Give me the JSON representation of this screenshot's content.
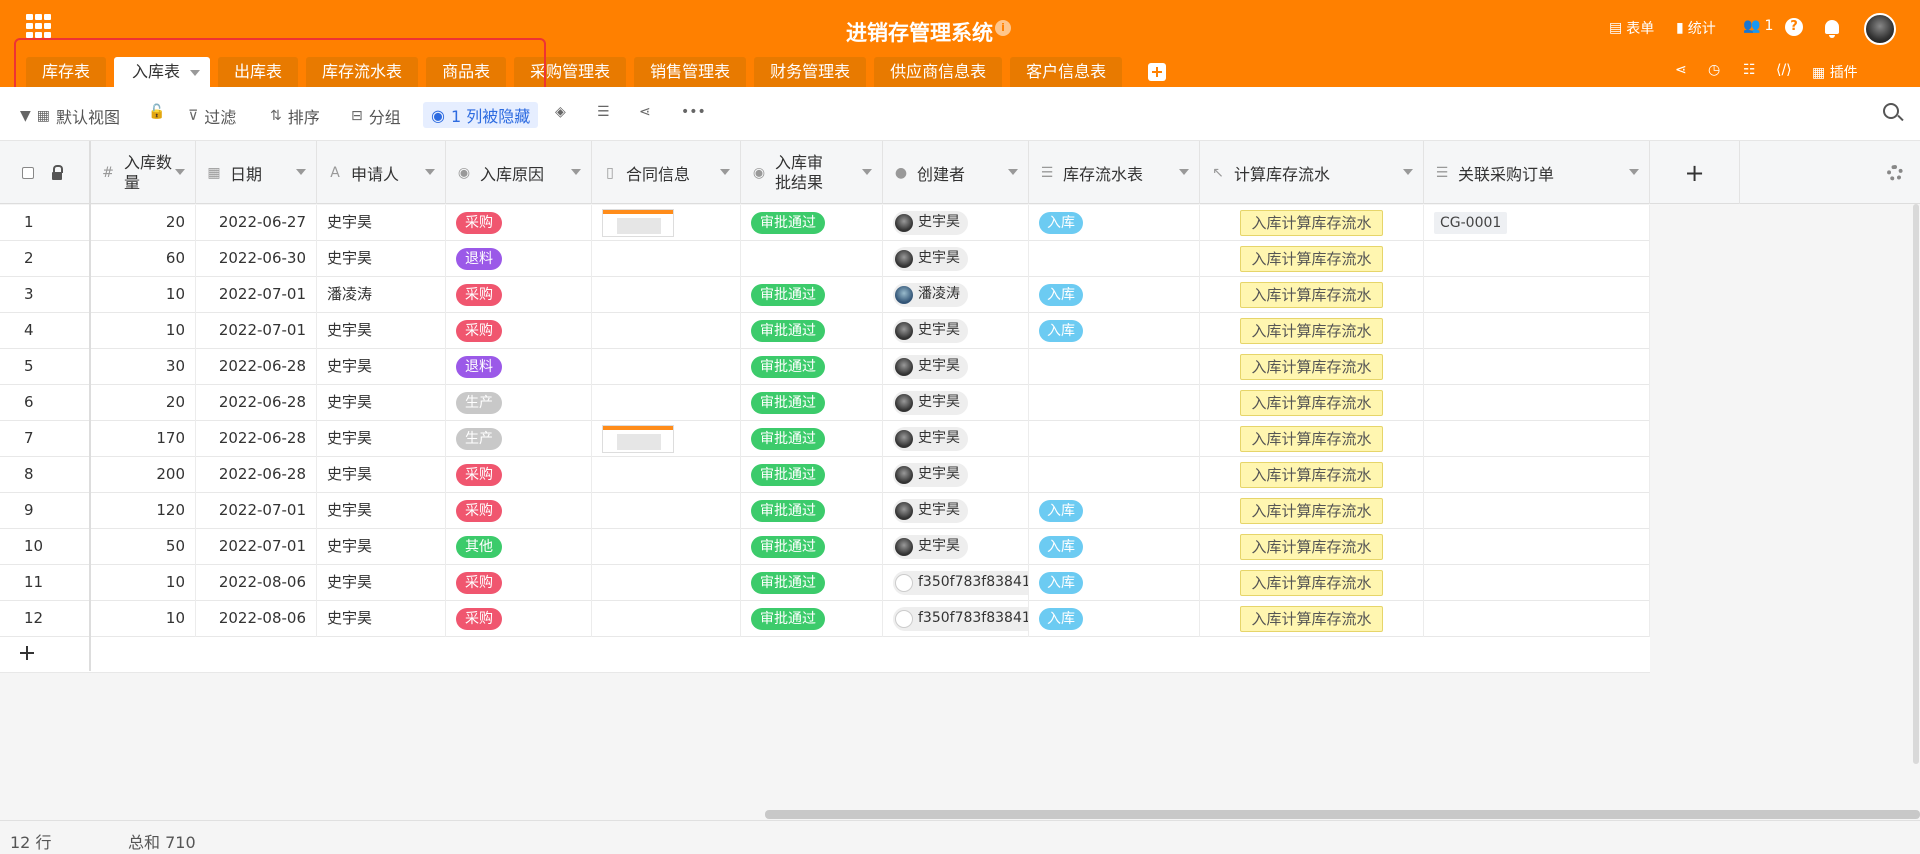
{
  "app": {
    "title": "进销存管理系统"
  },
  "header_right": {
    "form": "表单",
    "stats": "统计",
    "users_count": "1",
    "help": "?"
  },
  "tabs": [
    {
      "label": "库存表",
      "active": false
    },
    {
      "label": "入库表",
      "active": true
    },
    {
      "label": "出库表",
      "active": false
    },
    {
      "label": "库存流水表",
      "active": false
    },
    {
      "label": "商品表",
      "active": false
    },
    {
      "label": "采购管理表",
      "active": false
    },
    {
      "label": "销售管理表",
      "active": false
    },
    {
      "label": "财务管理表",
      "active": false
    },
    {
      "label": "供应商信息表",
      "active": false
    },
    {
      "label": "客户信息表",
      "active": false
    }
  ],
  "tab_tools": {
    "plugins": "插件"
  },
  "toolbar": {
    "view": "默认视图",
    "filter": "过滤",
    "sort": "排序",
    "group": "分组",
    "hidden": "1 列被隐藏"
  },
  "columns": [
    {
      "label": "入库数量",
      "icon": "#"
    },
    {
      "label": "日期",
      "icon": "▦"
    },
    {
      "label": "申请人",
      "icon": "A"
    },
    {
      "label": "入库原因",
      "icon": "◉"
    },
    {
      "label": "合同信息",
      "icon": "▯"
    },
    {
      "label": "入库审批结果",
      "icon": "◉"
    },
    {
      "label": "创建者",
      "icon": "●"
    },
    {
      "label": "库存流水表",
      "icon": "☰"
    },
    {
      "label": "计算库存流水",
      "icon": "↖"
    },
    {
      "label": "关联采购订单",
      "icon": "☰"
    }
  ],
  "colors": {
    "header_orange": "#ff8000",
    "采购": "#f0566f",
    "退料": "#9b59e8",
    "生产": "#c8c8c8",
    "其他": "#3ccb6b",
    "approved": "#3ccb6b"
  },
  "calc_button_label": "入库计算库存流水",
  "rows": [
    {
      "n": "1",
      "qty": "20",
      "date": "2022-06-27",
      "applicant": "史宇昊",
      "reason": "采购",
      "contract": true,
      "approval": "审批通过",
      "creator": "史宇昊",
      "avatar": "dark",
      "flow": "入库",
      "po": "CG-0001"
    },
    {
      "n": "2",
      "qty": "60",
      "date": "2022-06-30",
      "applicant": "史宇昊",
      "reason": "退料",
      "contract": false,
      "approval": "",
      "creator": "史宇昊",
      "avatar": "dark",
      "flow": "",
      "po": ""
    },
    {
      "n": "3",
      "qty": "10",
      "date": "2022-07-01",
      "applicant": "潘凌涛",
      "reason": "采购",
      "contract": false,
      "approval": "审批通过",
      "creator": "潘凌涛",
      "avatar": "blue",
      "flow": "入库",
      "po": ""
    },
    {
      "n": "4",
      "qty": "10",
      "date": "2022-07-01",
      "applicant": "史宇昊",
      "reason": "采购",
      "contract": false,
      "approval": "审批通过",
      "creator": "史宇昊",
      "avatar": "dark",
      "flow": "入库",
      "po": ""
    },
    {
      "n": "5",
      "qty": "30",
      "date": "2022-06-28",
      "applicant": "史宇昊",
      "reason": "退料",
      "contract": false,
      "approval": "审批通过",
      "creator": "史宇昊",
      "avatar": "dark",
      "flow": "",
      "po": ""
    },
    {
      "n": "6",
      "qty": "20",
      "date": "2022-06-28",
      "applicant": "史宇昊",
      "reason": "生产",
      "contract": false,
      "approval": "审批通过",
      "creator": "史宇昊",
      "avatar": "dark",
      "flow": "",
      "po": ""
    },
    {
      "n": "7",
      "qty": "170",
      "date": "2022-06-28",
      "applicant": "史宇昊",
      "reason": "生产",
      "contract": true,
      "approval": "审批通过",
      "creator": "史宇昊",
      "avatar": "dark",
      "flow": "",
      "po": ""
    },
    {
      "n": "8",
      "qty": "200",
      "date": "2022-06-28",
      "applicant": "史宇昊",
      "reason": "采购",
      "contract": false,
      "approval": "审批通过",
      "creator": "史宇昊",
      "avatar": "dark",
      "flow": "",
      "po": ""
    },
    {
      "n": "9",
      "qty": "120",
      "date": "2022-07-01",
      "applicant": "史宇昊",
      "reason": "采购",
      "contract": false,
      "approval": "审批通过",
      "creator": "史宇昊",
      "avatar": "dark",
      "flow": "入库",
      "po": ""
    },
    {
      "n": "10",
      "qty": "50",
      "date": "2022-07-01",
      "applicant": "史宇昊",
      "reason": "其他",
      "contract": false,
      "approval": "审批通过",
      "creator": "史宇昊",
      "avatar": "dark",
      "flow": "入库",
      "po": ""
    },
    {
      "n": "11",
      "qty": "10",
      "date": "2022-08-06",
      "applicant": "史宇昊",
      "reason": "采购",
      "contract": false,
      "approval": "审批通过",
      "creator": "f350f783f83841",
      "avatar": "blank",
      "flow": "入库",
      "po": ""
    },
    {
      "n": "12",
      "qty": "10",
      "date": "2022-08-06",
      "applicant": "史宇昊",
      "reason": "采购",
      "contract": false,
      "approval": "审批通过",
      "creator": "f350f783f83841",
      "avatar": "blank",
      "flow": "入库",
      "po": ""
    }
  ],
  "footer": {
    "rows": "12 行",
    "sum": "总和 710"
  }
}
